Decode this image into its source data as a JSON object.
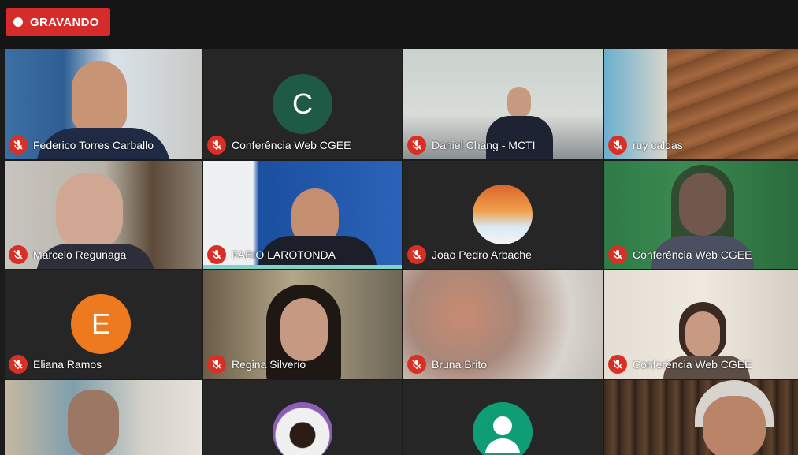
{
  "recording": {
    "label": "GRAVANDO"
  },
  "tiles": [
    {
      "name": "Federico Torres Carballo"
    },
    {
      "name": "Conferência Web CGEE",
      "avatar_letter": "C",
      "avatar_color": "#1e5a45"
    },
    {
      "name": "Daniel Chang - MCTI"
    },
    {
      "name": "ruy caldas"
    },
    {
      "name": "Marcelo Regunaga"
    },
    {
      "name": "FABIO LAROTONDA"
    },
    {
      "name": "Joao Pedro Arbache"
    },
    {
      "name": "Conferência Web CGEE"
    },
    {
      "name": "Eliana Ramos",
      "avatar_letter": "E",
      "avatar_color": "#ee7a1f"
    },
    {
      "name": "Regina Silverio"
    },
    {
      "name": "Bruna Brito"
    },
    {
      "name": "Conferência Web CGEE"
    }
  ],
  "colors": {
    "muted_mic": "#d93025",
    "recording": "#d62b2b",
    "active_speaker": "#7fd3c8"
  },
  "icons": {
    "mic": "mic-off-icon",
    "record": "record-dot-icon"
  }
}
